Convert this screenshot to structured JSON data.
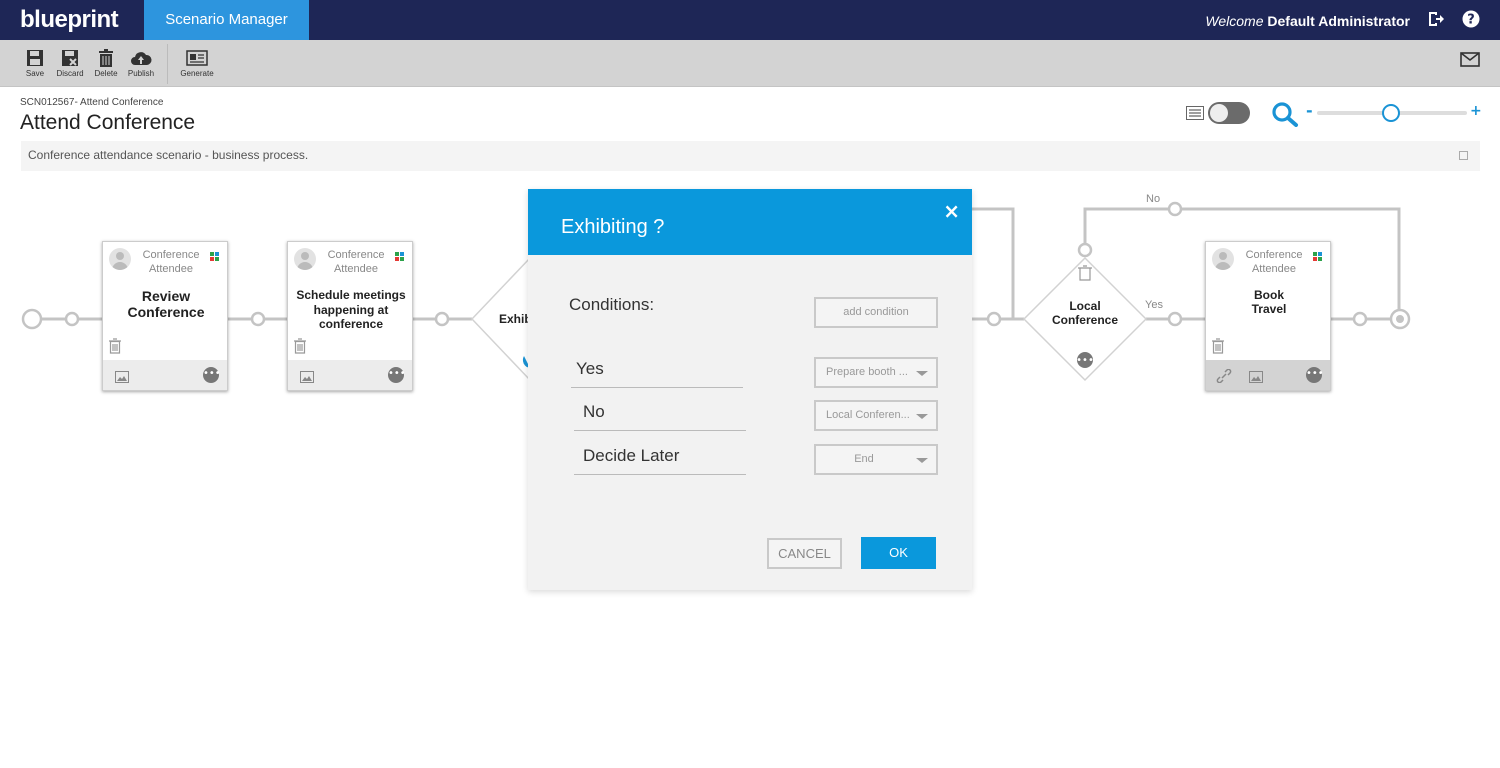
{
  "header": {
    "logo": "blueprint",
    "app_tab": "Scenario Manager",
    "welcome_prefix": "Welcome",
    "user_name": "Default Administrator"
  },
  "toolbar": {
    "save": "Save",
    "discard": "Discard",
    "delete": "Delete",
    "publish": "Publish",
    "generate": "Generate"
  },
  "page": {
    "breadcrumb": "SCN012567- Attend Conference",
    "title": "Attend Conference",
    "description": "Conference attendance scenario - business process."
  },
  "zoom": {
    "minus": "-",
    "plus": "+",
    "level": 0.5
  },
  "diagram": {
    "cards": [
      {
        "actor": "Conference Attendee",
        "name": "Review Conference"
      },
      {
        "actor": "Conference Attendee",
        "name": "Schedule meetings happening at conference"
      },
      {
        "actor": "Conference Attendee",
        "name": "Book Travel"
      }
    ],
    "decision_partial": "Exhibi",
    "decision2": "Local Conference",
    "edge_no": "No",
    "edge_yes": "Yes"
  },
  "modal": {
    "title": "Exhibiting ?",
    "close": "×",
    "conditions_label": "Conditions:",
    "add_condition": "add condition",
    "conditions": [
      {
        "label": "Yes",
        "target": "Prepare booth ..."
      },
      {
        "label": "No",
        "target": "Local Conferen..."
      },
      {
        "label": "Decide Later",
        "target": "End"
      }
    ],
    "cancel": "CANCEL",
    "ok": "OK"
  },
  "colors": {
    "topbar": "#1e2656",
    "accent": "#0a98dc",
    "toolbar": "#d3d3d3"
  }
}
